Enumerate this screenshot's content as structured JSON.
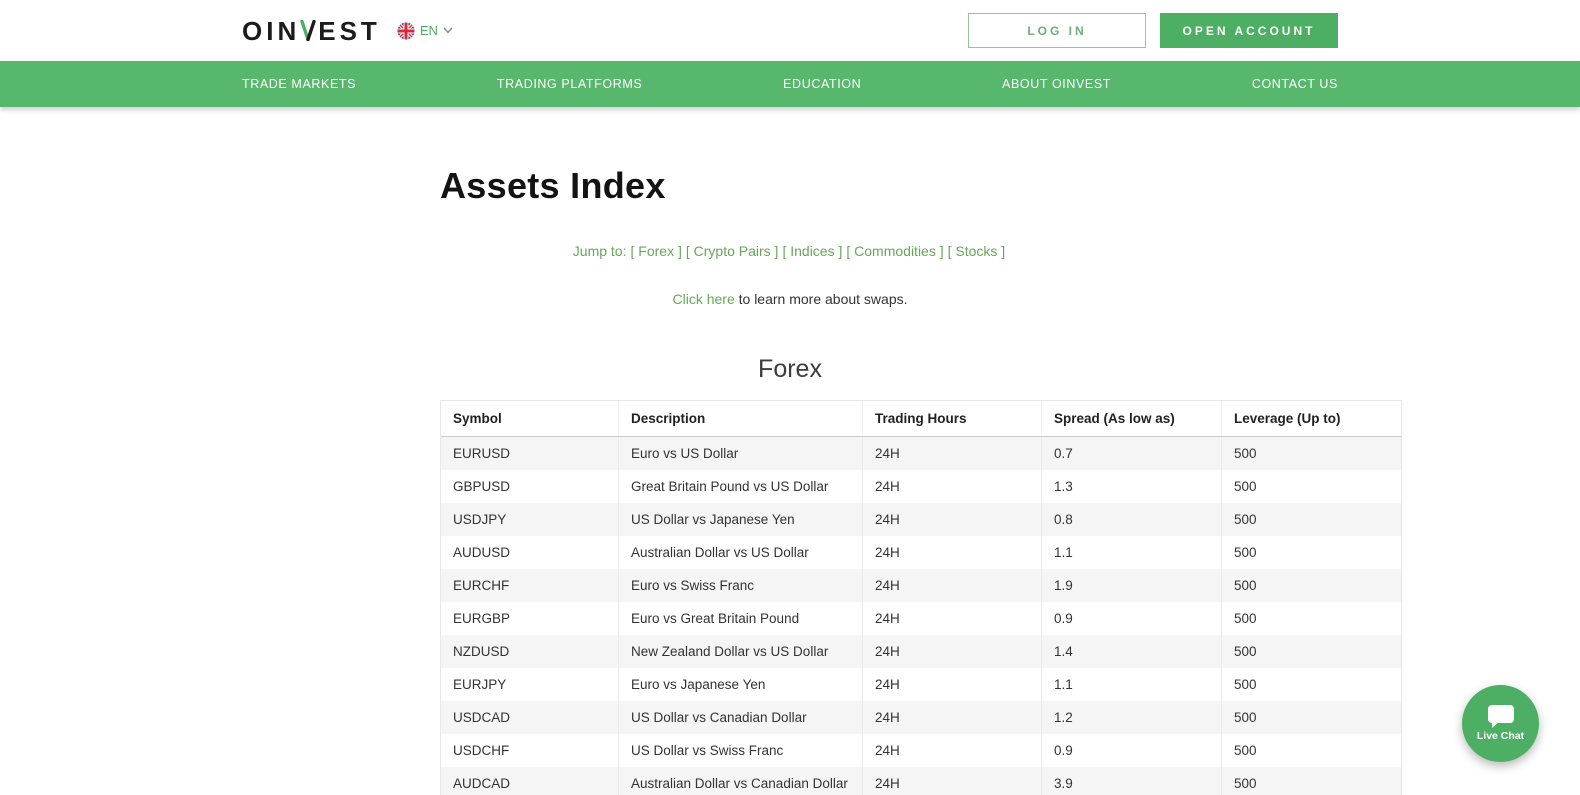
{
  "header": {
    "logo_prefix": "OIN",
    "logo_v": "V",
    "logo_suffix": "EST",
    "language": "EN",
    "login_label": "LOG IN",
    "open_account_label": "OPEN ACCOUNT"
  },
  "nav": {
    "items": [
      {
        "label": "TRADE MARKETS"
      },
      {
        "label": "TRADING PLATFORMS"
      },
      {
        "label": "EDUCATION"
      },
      {
        "label": "ABOUT OINVEST"
      },
      {
        "label": "CONTACT US"
      }
    ]
  },
  "main": {
    "title": "Assets Index",
    "jump_to": {
      "prefix": "Jump to:",
      "links": [
        {
          "label": "[ Forex ]"
        },
        {
          "label": "[ Crypto Pairs ]"
        },
        {
          "label": "[ Indices ]"
        },
        {
          "label": "[ Commodities ]"
        },
        {
          "label": "[ Stocks ]"
        }
      ]
    },
    "swaps_note": {
      "link": "Click here",
      "text": " to learn more about swaps."
    },
    "section_title": "Forex",
    "table": {
      "headers": [
        "Symbol",
        "Description",
        "Trading Hours",
        "Spread (As low as)",
        "Leverage (Up to)"
      ],
      "rows": [
        {
          "symbol": "EURUSD",
          "description": "Euro vs US Dollar",
          "hours": "24H",
          "spread": "0.7",
          "leverage": "500"
        },
        {
          "symbol": "GBPUSD",
          "description": "Great Britain Pound vs US Dollar",
          "hours": "24H",
          "spread": "1.3",
          "leverage": "500"
        },
        {
          "symbol": "USDJPY",
          "description": "US Dollar vs Japanese Yen",
          "hours": "24H",
          "spread": "0.8",
          "leverage": "500"
        },
        {
          "symbol": "AUDUSD",
          "description": "Australian Dollar vs US Dollar",
          "hours": "24H",
          "spread": "1.1",
          "leverage": "500"
        },
        {
          "symbol": "EURCHF",
          "description": "Euro vs Swiss Franc",
          "hours": "24H",
          "spread": "1.9",
          "leverage": "500"
        },
        {
          "symbol": "EURGBP",
          "description": "Euro vs Great Britain Pound",
          "hours": "24H",
          "spread": "0.9",
          "leverage": "500"
        },
        {
          "symbol": "NZDUSD",
          "description": "New Zealand Dollar vs US Dollar",
          "hours": "24H",
          "spread": "1.4",
          "leverage": "500"
        },
        {
          "symbol": "EURJPY",
          "description": "Euro vs Japanese Yen",
          "hours": "24H",
          "spread": "1.1",
          "leverage": "500"
        },
        {
          "symbol": "USDCAD",
          "description": "US Dollar vs Canadian Dollar",
          "hours": "24H",
          "spread": "1.2",
          "leverage": "500"
        },
        {
          "symbol": "USDCHF",
          "description": "US Dollar vs Swiss Franc",
          "hours": "24H",
          "spread": "0.9",
          "leverage": "500"
        },
        {
          "symbol": "AUDCAD",
          "description": "Australian Dollar vs Canadian Dollar",
          "hours": "24H",
          "spread": "3.9",
          "leverage": "500"
        }
      ]
    }
  },
  "chat": {
    "label": "Live Chat"
  },
  "colors": {
    "accent": "#4caf63",
    "nav_green": "#57b76d",
    "link_green": "#67a758",
    "row_alt": "#f5f5f5"
  }
}
